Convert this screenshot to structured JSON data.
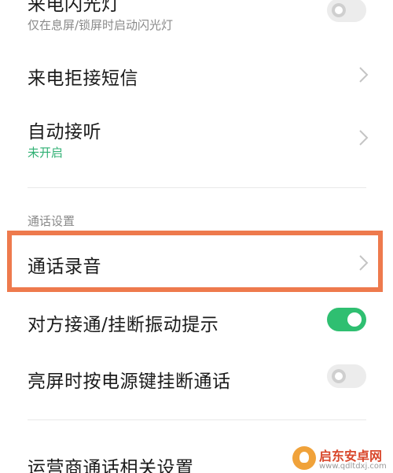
{
  "items": {
    "flash": {
      "title": "来电闪光灯",
      "subtitle": "仅在息屏/锁屏时启动闪光灯",
      "enabled": false
    },
    "reject_sms": {
      "title": "来电拒接短信"
    },
    "auto_answer": {
      "title": "自动接听",
      "status": "未开启"
    },
    "call_section": {
      "header": "通话设置"
    },
    "call_recording": {
      "title": "通话录音"
    },
    "vibrate_on_connect": {
      "title": "对方接通/挂断振动提示",
      "enabled": true
    },
    "power_key_hangup": {
      "title": "亮屏时按电源键挂断通话",
      "enabled": false
    },
    "carrier_settings": {
      "title": "运营商通话相关设置"
    }
  },
  "colors": {
    "accent_green": "#2fbf71",
    "highlight_orange": "#ee7a4d"
  },
  "watermark": {
    "name": "启东安卓网",
    "url": "www.qdltdxj.com"
  }
}
